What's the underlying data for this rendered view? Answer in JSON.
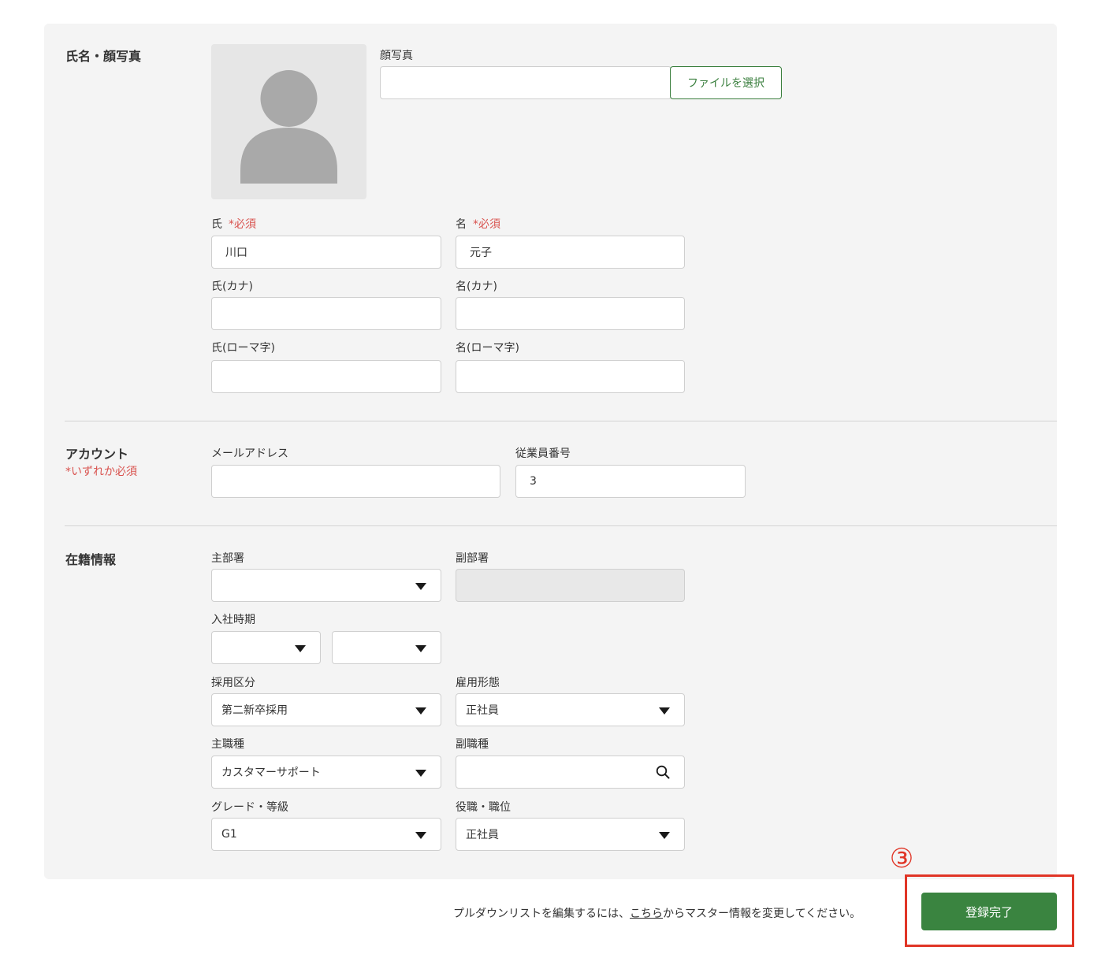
{
  "profile": {
    "section_title": "氏名・顔写真",
    "photo_label": "顔写真",
    "file_button": "ファイルを選択",
    "last_name_label": "氏",
    "first_name_label": "名",
    "required_mark": "*必須",
    "last_name_value": "川口",
    "first_name_value": "元子",
    "last_name_kana_label": "氏(カナ)",
    "first_name_kana_label": "名(カナ)",
    "last_name_roman_label": "氏(ローマ字)",
    "first_name_roman_label": "名(ローマ字)"
  },
  "account": {
    "section_title": "アカウント",
    "required_note": "*いずれか必須",
    "email_label": "メールアドレス",
    "email_value": "",
    "employee_no_label": "従業員番号",
    "employee_no_value": "3"
  },
  "employment": {
    "section_title": "在籍情報",
    "main_dept_label": "主部署",
    "main_dept_value": "",
    "sub_dept_label": "副部署",
    "join_date_label": "入社時期",
    "join_year_value": "",
    "join_month_value": "",
    "hiring_type_label": "採用区分",
    "hiring_type_value": "第二新卒採用",
    "employment_type_label": "雇用形態",
    "employment_type_value": "正社員",
    "main_job_label": "主職種",
    "main_job_value": "カスタマーサポート",
    "sub_job_label": "副職種",
    "sub_job_value": "",
    "grade_label": "グレード・等級",
    "grade_value": "G1",
    "position_label": "役職・職位",
    "position_value": "正社員"
  },
  "footer": {
    "note_prefix": "プルダウンリストを編集するには、",
    "note_link": "こちら",
    "note_suffix": "からマスター情報を変更してください。",
    "submit_label": "登録完了",
    "callout_number": "③"
  },
  "colors": {
    "accent_green": "#3a8440",
    "required_red": "#d9534f",
    "callout_red": "#e03526",
    "panel_bg": "#f4f4f4"
  }
}
